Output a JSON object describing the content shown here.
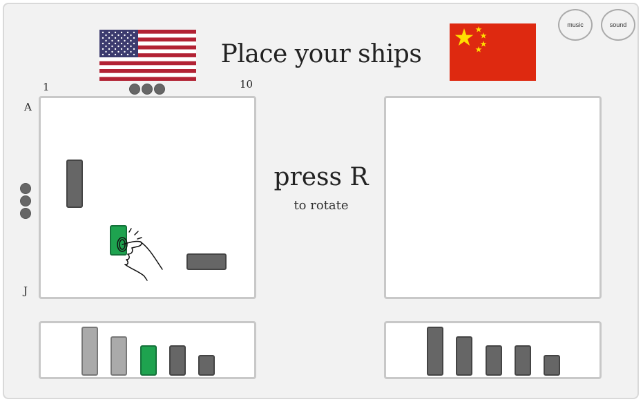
{
  "title": "Place your ships",
  "controls": {
    "music_label": "music",
    "sound_label": "sound"
  },
  "player": {
    "flag_icon": "usa-flag",
    "col_start_label": "1",
    "col_end_label": "10",
    "row_start_label": "A",
    "row_end_label": "J",
    "ships_in_tray": 5
  },
  "opponent": {
    "flag_icon": "china-flag",
    "ships_in_tray": 5
  },
  "hint": {
    "main": "press R",
    "sub": "to rotate"
  },
  "colors": {
    "selected_ship": "#1ea34f",
    "placed_ship": "#666666",
    "used_ship": "#aaaaaa",
    "background": "#f2f2f2"
  }
}
